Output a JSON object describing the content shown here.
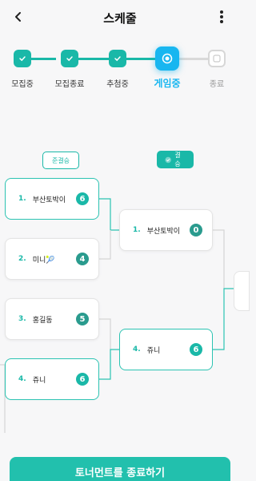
{
  "header": {
    "title": "스케줄"
  },
  "stepper": {
    "steps": [
      {
        "label": "모집중"
      },
      {
        "label": "모집종료"
      },
      {
        "label": "추첨중"
      },
      {
        "label": "게임중"
      },
      {
        "label": "종료"
      }
    ]
  },
  "rounds": {
    "semi": "준결승",
    "final": "결승"
  },
  "semifinal": [
    {
      "seed": "1.",
      "name": "부산토박이",
      "score": "6"
    },
    {
      "seed": "2.",
      "name": "미니🎾",
      "score": "4"
    },
    {
      "seed": "3.",
      "name": "홍길동",
      "score": "5"
    },
    {
      "seed": "4.",
      "name": "쥬니",
      "score": "6"
    }
  ],
  "final": [
    {
      "seed": "1.",
      "name": "부산토박이",
      "score": "0"
    },
    {
      "seed": "4.",
      "name": "쥬니",
      "score": "6"
    }
  ],
  "actions": {
    "end_button": "토너먼트를 종료하기"
  },
  "colors": {
    "accent": "#1ab8a8",
    "active": "#18b6f0"
  }
}
